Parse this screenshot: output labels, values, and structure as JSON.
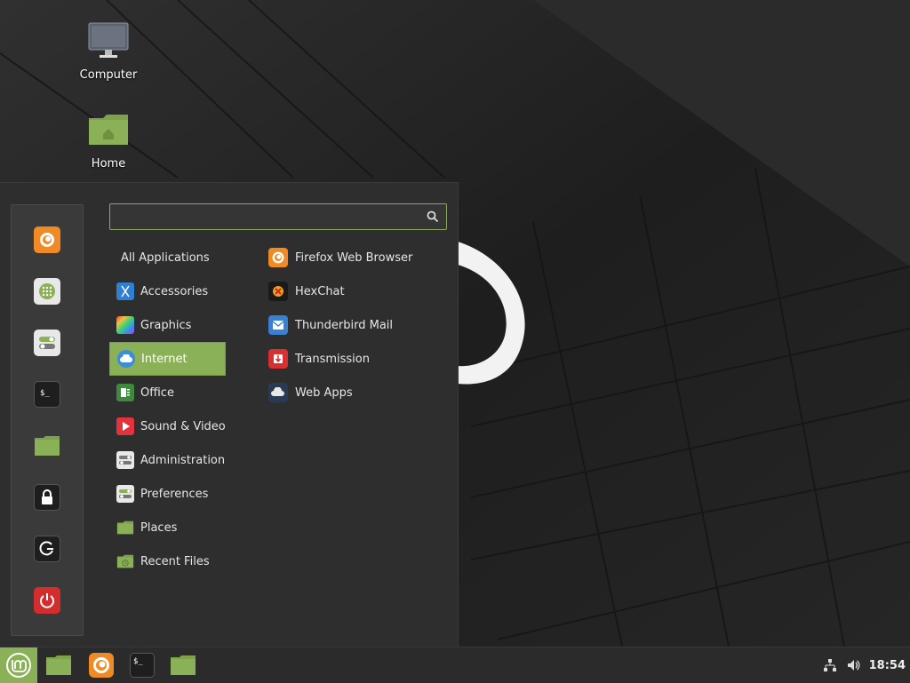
{
  "desktop": {
    "icons": [
      {
        "label": "Computer",
        "icon": "computer-icon"
      },
      {
        "label": "Home",
        "icon": "home-folder-icon"
      }
    ]
  },
  "menu": {
    "search": {
      "value": "",
      "placeholder": ""
    },
    "favorites": [
      {
        "name": "firefox",
        "icon": "firefox-icon"
      },
      {
        "name": "software-manager",
        "icon": "software-manager-icon"
      },
      {
        "name": "system-settings",
        "icon": "settings-icon"
      },
      {
        "name": "terminal",
        "icon": "terminal-icon"
      },
      {
        "name": "files",
        "icon": "folder-icon"
      },
      {
        "name": "lock-screen",
        "icon": "lock-icon"
      },
      {
        "name": "logout",
        "icon": "logout-icon"
      },
      {
        "name": "quit",
        "icon": "power-icon"
      }
    ],
    "categories": [
      {
        "label": "All Applications"
      },
      {
        "label": "Accessories"
      },
      {
        "label": "Graphics"
      },
      {
        "label": "Internet",
        "selected": true
      },
      {
        "label": "Office"
      },
      {
        "label": "Sound & Video"
      },
      {
        "label": "Administration"
      },
      {
        "label": "Preferences"
      },
      {
        "label": "Places"
      },
      {
        "label": "Recent Files"
      }
    ],
    "apps": [
      {
        "label": "Firefox Web Browser"
      },
      {
        "label": "HexChat"
      },
      {
        "label": "Thunderbird Mail"
      },
      {
        "label": "Transmission"
      },
      {
        "label": "Web Apps"
      }
    ]
  },
  "taskbar": {
    "clock": "18:54"
  },
  "colors": {
    "accent": "#8bb158",
    "panel": "#2e2e2e"
  }
}
